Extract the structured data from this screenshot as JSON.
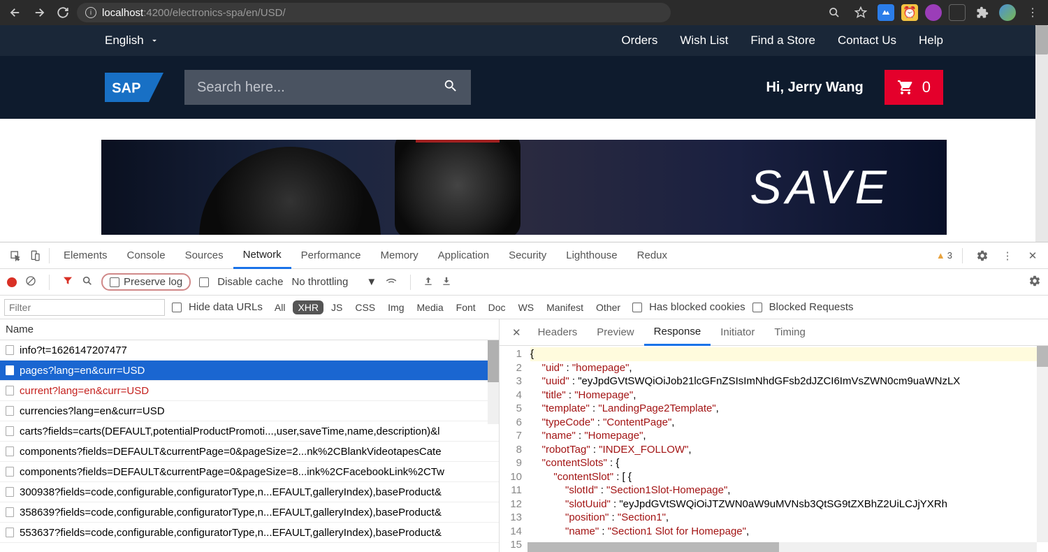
{
  "browser": {
    "url_host": "localhost",
    "url_rest": ":4200/electronics-spa/en/USD/"
  },
  "page": {
    "language": "English",
    "top_links": [
      "Orders",
      "Wish List",
      "Find a Store",
      "Contact Us",
      "Help"
    ],
    "search_placeholder": "Search here...",
    "greeting": "Hi, Jerry Wang",
    "cart_count": "0",
    "hero_text": "SAVE"
  },
  "devtools": {
    "tabs": [
      "Elements",
      "Console",
      "Sources",
      "Network",
      "Performance",
      "Memory",
      "Application",
      "Security",
      "Lighthouse",
      "Redux"
    ],
    "active_tab": "Network",
    "warning_count": "3",
    "toolbar": {
      "preserve_log": "Preserve log",
      "disable_cache": "Disable cache",
      "throttling": "No throttling"
    },
    "filter": {
      "placeholder": "Filter",
      "hide_urls": "Hide data URLs",
      "types": [
        "All",
        "XHR",
        "JS",
        "CSS",
        "Img",
        "Media",
        "Font",
        "Doc",
        "WS",
        "Manifest",
        "Other"
      ],
      "active_type": "XHR",
      "blocked_cookies": "Has blocked cookies",
      "blocked_requests": "Blocked Requests"
    },
    "name_header": "Name",
    "requests": [
      {
        "name": "info?t=1626147207477",
        "state": ""
      },
      {
        "name": "pages?lang=en&curr=USD",
        "state": "sel"
      },
      {
        "name": "current?lang=en&curr=USD",
        "state": "err"
      },
      {
        "name": "currencies?lang=en&curr=USD",
        "state": ""
      },
      {
        "name": "carts?fields=carts(DEFAULT,potentialProductPromoti...,user,saveTime,name,description)&l",
        "state": ""
      },
      {
        "name": "components?fields=DEFAULT&currentPage=0&pageSize=2...nk%2CBlankVideotapesCate",
        "state": ""
      },
      {
        "name": "components?fields=DEFAULT&currentPage=0&pageSize=8...ink%2CFacebookLink%2CTw",
        "state": ""
      },
      {
        "name": "300938?fields=code,configurable,configuratorType,n...EFAULT,galleryIndex),baseProduct&",
        "state": ""
      },
      {
        "name": "358639?fields=code,configurable,configuratorType,n...EFAULT,galleryIndex),baseProduct&",
        "state": ""
      },
      {
        "name": "553637?fields=code,configurable,configuratorType,n...EFAULT,galleryIndex),baseProduct&",
        "state": ""
      }
    ],
    "response_tabs": [
      "Headers",
      "Preview",
      "Response",
      "Initiator",
      "Timing"
    ],
    "response_active": "Response",
    "code_lines": [
      {
        "n": 1,
        "t": "{",
        "hl": true
      },
      {
        "n": 2,
        "t": "    \"uid\" : \"homepage\","
      },
      {
        "n": 3,
        "t": "    \"uuid\" : \"eyJpdGVtSWQiOiJob21lcGFnZSIsImNhdGFsb2dJZCI6ImVsZWN0cm9uaWNzLX"
      },
      {
        "n": 4,
        "t": "    \"title\" : \"Homepage\","
      },
      {
        "n": 5,
        "t": "    \"template\" : \"LandingPage2Template\","
      },
      {
        "n": 6,
        "t": "    \"typeCode\" : \"ContentPage\","
      },
      {
        "n": 7,
        "t": "    \"name\" : \"Homepage\","
      },
      {
        "n": 8,
        "t": "    \"robotTag\" : \"INDEX_FOLLOW\","
      },
      {
        "n": 9,
        "t": "    \"contentSlots\" : {"
      },
      {
        "n": 10,
        "t": "        \"contentSlot\" : [ {"
      },
      {
        "n": 11,
        "t": "            \"slotId\" : \"Section1Slot-Homepage\","
      },
      {
        "n": 12,
        "t": "            \"slotUuid\" : \"eyJpdGVtSWQiOiJTZWN0aW9uMVNsb3QtSG9tZXBhZ2UiLCJjYXRh"
      },
      {
        "n": 13,
        "t": "            \"position\" : \"Section1\","
      },
      {
        "n": 14,
        "t": "            \"name\" : \"Section1 Slot for Homepage\","
      },
      {
        "n": 15,
        "t": ""
      }
    ]
  }
}
